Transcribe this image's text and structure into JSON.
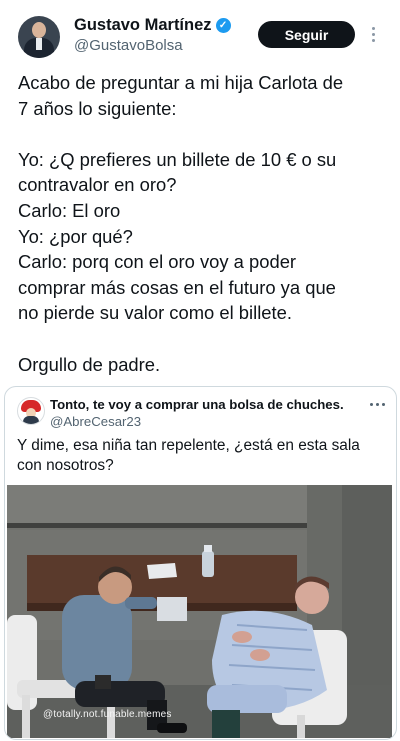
{
  "author": {
    "name": "Gustavo Martínez",
    "handle": "@GustavoBolsa",
    "follow_label": "Seguir"
  },
  "tweet": {
    "lines": [
      "Acabo de preguntar a mi hija Carlota de",
      "7 años lo siguiente:",
      "",
      "Yo: ¿Q prefieres un billete de 10 € o su",
      "contravalor en oro?",
      "Carlo: El oro",
      "Yo: ¿por qué?",
      "Carlo: porq con el oro voy a poder",
      "comprar más cosas en el futuro ya que",
      "no pierde su valor como el billete.",
      "",
      "Orgullo de padre."
    ]
  },
  "quote": {
    "title": "Tonto, te voy a comprar una bolsa de chuches.",
    "handle": "@AbreCesar23",
    "text_lines": [
      "Y dime, esa niña tan repelente, ¿está en esta sala",
      "con nosotros?"
    ],
    "watermark": "@totally.not.funable.memes"
  },
  "colors": {
    "verified": "#1d9bf0",
    "follow_button": "#0f1419",
    "secondary_text": "#536471"
  }
}
